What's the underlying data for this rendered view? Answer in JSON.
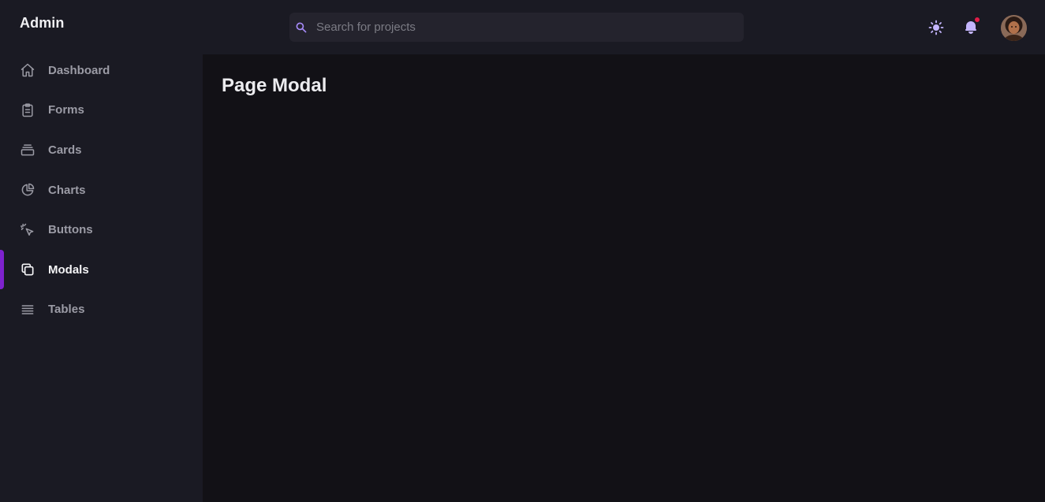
{
  "sidebar": {
    "brand": "Admin",
    "items": [
      {
        "label": "Dashboard",
        "icon": "home-icon",
        "active": false
      },
      {
        "label": "Forms",
        "icon": "clipboard-icon",
        "active": false
      },
      {
        "label": "Cards",
        "icon": "cards-icon",
        "active": false
      },
      {
        "label": "Charts",
        "icon": "pie-chart-icon",
        "active": false
      },
      {
        "label": "Buttons",
        "icon": "cursor-click-icon",
        "active": false
      },
      {
        "label": "Modals",
        "icon": "duplicate-icon",
        "active": true
      },
      {
        "label": "Tables",
        "icon": "list-icon",
        "active": false
      }
    ],
    "active_color": "#7e22ce"
  },
  "header": {
    "search": {
      "placeholder": "Search for projects",
      "value": "",
      "icon": "search-icon"
    },
    "theme_toggle_icon": "sun-icon",
    "notifications_icon": "bell-icon",
    "notification_dot_color": "#e11d48",
    "avatar": "user-avatar"
  },
  "main": {
    "title": "Page Modal"
  },
  "colors": {
    "accent": "#7e22ce",
    "icon_accent": "#c4b5fd",
    "sidebar_bg": "#1a1a23",
    "main_bg": "#121116"
  }
}
